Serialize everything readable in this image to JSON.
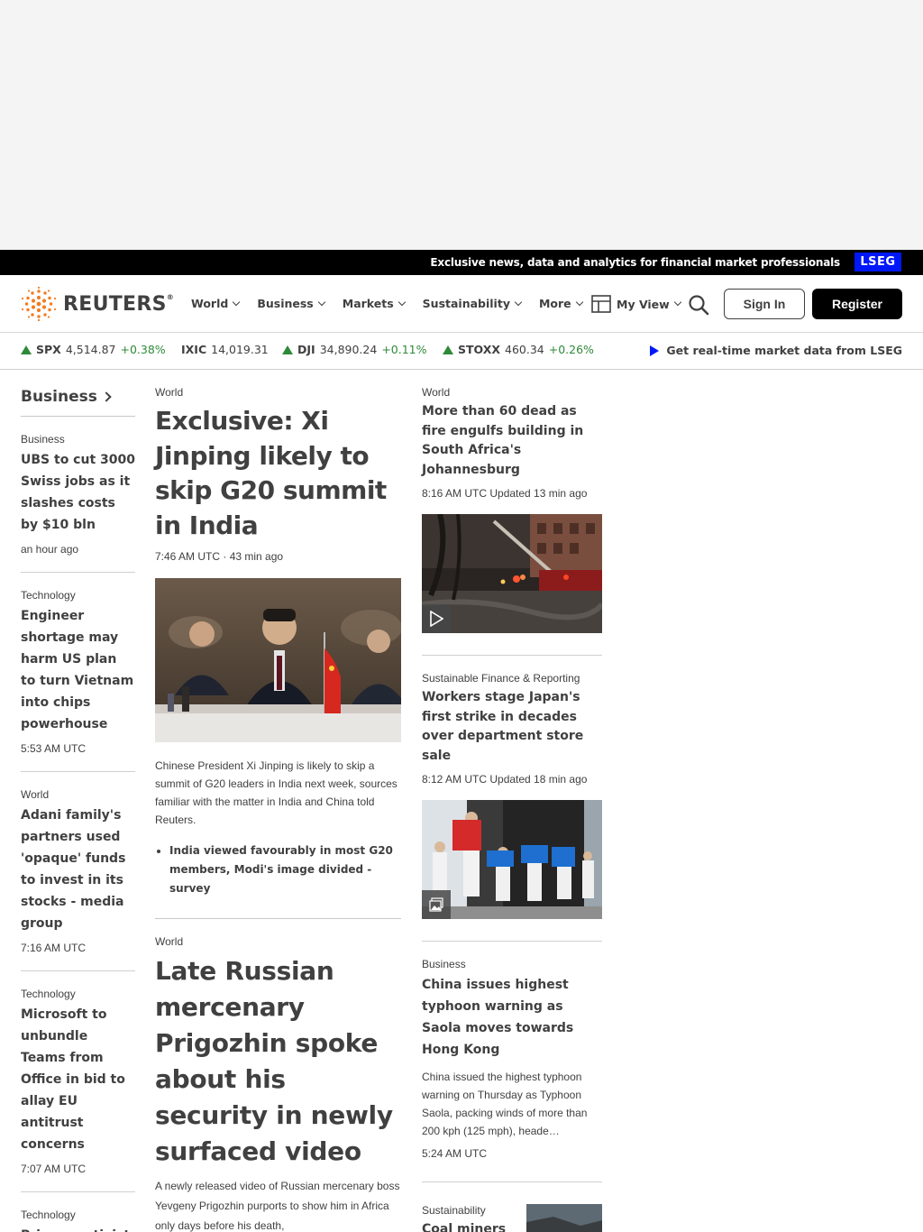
{
  "promo": {
    "text": "Exclusive news, data and analytics for financial market professionals",
    "badge": "LSEG"
  },
  "brand": {
    "name": "REUTERS",
    "mark": "®"
  },
  "nav": {
    "items": [
      {
        "label": "World"
      },
      {
        "label": "Business"
      },
      {
        "label": "Markets"
      },
      {
        "label": "Sustainability"
      },
      {
        "label": "More"
      }
    ],
    "myview": "My View",
    "signin": "Sign In",
    "register": "Register"
  },
  "ticker": [
    {
      "symbol": "SPX",
      "value": "4,514.87",
      "change": "+0.38%",
      "direction": "up"
    },
    {
      "symbol": "IXIC",
      "value": "14,019.31",
      "change": "",
      "direction": "none"
    },
    {
      "symbol": "DJI",
      "value": "34,890.24",
      "change": "+0.11%",
      "direction": "up"
    },
    {
      "symbol": "STOXX",
      "value": "460.34",
      "change": "+0.26%",
      "direction": "up"
    }
  ],
  "lseg_link": "Get real-time market data from LSEG",
  "colors": {
    "accent_blue": "#0018f9",
    "up_green": "#2e8a38",
    "text": "#404040"
  },
  "sidebar": {
    "title": "Business",
    "stories": [
      {
        "kicker": "Business",
        "title": "UBS to cut 3000 Swiss jobs as it slashes costs by $10 bln",
        "time": "an hour ago"
      },
      {
        "kicker": "Technology",
        "title": "Engineer shortage may harm US plan to turn Vietnam into chips powerhouse",
        "time": "5:53 AM UTC"
      },
      {
        "kicker": "World",
        "title": "Adani family's partners used 'opaque' funds to invest in its stocks - media group",
        "time": "7:16 AM UTC"
      },
      {
        "kicker": "Technology",
        "title": "Microsoft to unbundle Teams from Office in bid to allay EU antitrust concerns",
        "time": "7:07 AM UTC"
      },
      {
        "kicker": "Technology",
        "title": "Privacy activist",
        "time": ""
      }
    ]
  },
  "lead": {
    "kicker": "World",
    "title": "Exclusive: Xi Jinping likely to skip G20 summit in India",
    "time": "7:46 AM UTC · 43 min ago",
    "description": "Chinese President Xi Jinping is likely to skip a summit of G20 leaders in India next week, sources familiar with the matter in India and China told Reuters.",
    "bullets": [
      "India viewed favourably in most G20 members, Modi's image divided - survey"
    ]
  },
  "lead2": {
    "kicker": "World",
    "title": "Late Russian mercenary Prigozhin spoke about his security in newly surfaced video",
    "description": "A newly released video of Russian mercenary boss Yevgeny Prigozhin purports to show him in Africa only days before his death,"
  },
  "right": {
    "stories": [
      {
        "kicker": "World",
        "title": "More than 60 dead as fire engulfs building in South Africa's Johannesburg",
        "time": "8:16 AM UTC Updated 13 min ago",
        "media": "video"
      },
      {
        "kicker": "Sustainable Finance & Reporting",
        "title": "Workers stage Japan's first strike in decades over department store sale",
        "time": "8:12 AM UTC Updated 18 min ago",
        "media": "gallery"
      },
      {
        "kicker": "Business",
        "title": "China issues highest typhoon warning as Saola moves towards Hong Kong",
        "description": "China issued the highest typhoon warning on Thursday as Typhoon Saola, packing winds of more than 200 kph (125 mph), heade…",
        "time": "5:24 AM UTC"
      }
    ],
    "small": {
      "kicker": "Sustainability",
      "title": "Coal miners forced to save"
    }
  }
}
